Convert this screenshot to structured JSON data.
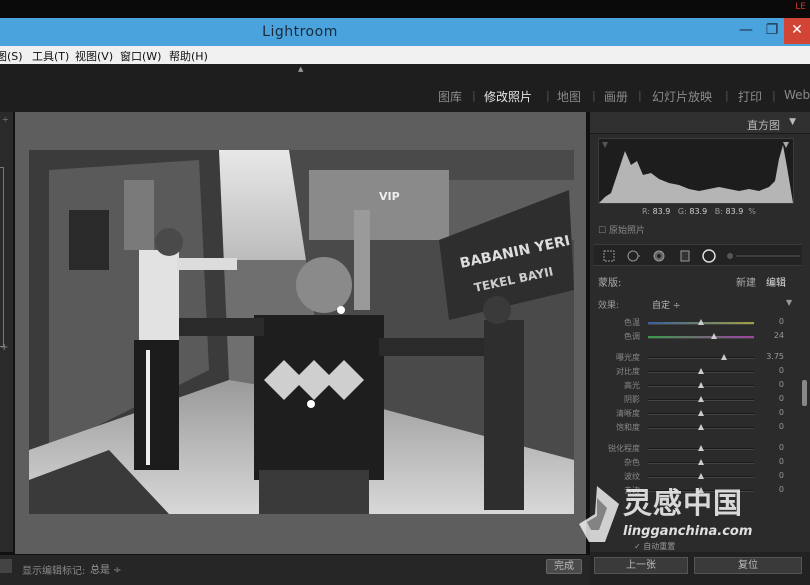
{
  "app": {
    "title": "Lightroom",
    "tray_tag": "LE"
  },
  "window_buttons": {
    "minimize": "—",
    "maximize": "❐",
    "close": "✕"
  },
  "menu": [
    "图(S)",
    "工具(T)",
    "视图(V)",
    "窗口(W)",
    "帮助(H)"
  ],
  "modules": [
    "图库",
    "修改照片",
    "地图",
    "画册",
    "幻灯片放映",
    "打印",
    "Web"
  ],
  "active_module": "修改照片",
  "right_panel": {
    "histogram_label": "直方图",
    "readout": {
      "r_label": "R",
      "r": "83.9",
      "g_label": "G",
      "g": "83.9",
      "b_label": "B",
      "b": "83.9",
      "unit": "%"
    },
    "original_photo": "原始照片",
    "mask_label": "蒙版:",
    "new": "新建",
    "edit": "编辑",
    "effect_label": "效果:",
    "effect_value": "自定 ÷",
    "sliders": [
      {
        "label": "色温",
        "value": "0",
        "pos": 0.5
      },
      {
        "label": "色调",
        "value": "24",
        "pos": 0.62
      },
      {
        "label": "曝光度",
        "value": "3.75",
        "pos": 0.72
      },
      {
        "label": "对比度",
        "value": "0",
        "pos": 0.5
      },
      {
        "label": "高光",
        "value": "0",
        "pos": 0.5
      },
      {
        "label": "阴影",
        "value": "0",
        "pos": 0.5
      },
      {
        "label": "清晰度",
        "value": "0",
        "pos": 0.5
      },
      {
        "label": "饱和度",
        "value": "0",
        "pos": 0.5
      },
      {
        "label": "锐化程度",
        "value": "0",
        "pos": 0.5
      },
      {
        "label": "杂色",
        "value": "0",
        "pos": 0.5
      },
      {
        "label": "波纹",
        "value": "0",
        "pos": 0.5
      },
      {
        "label": "去边",
        "value": "0",
        "pos": 0.5
      }
    ],
    "denoise": "✓ 自动重置",
    "prev_button": "上一张",
    "reset_button": "复位"
  },
  "toolbar": {
    "show_edit": "显示编辑标记:",
    "total": "总是 ÷",
    "finish": "完成"
  },
  "photo_signs": {
    "sign1": "BABANIN YERI",
    "sign2": "TEKEL BAYII",
    "sign3": "VIP"
  },
  "watermark": {
    "cn": "灵感中国",
    "en": "lingganchina.com"
  }
}
